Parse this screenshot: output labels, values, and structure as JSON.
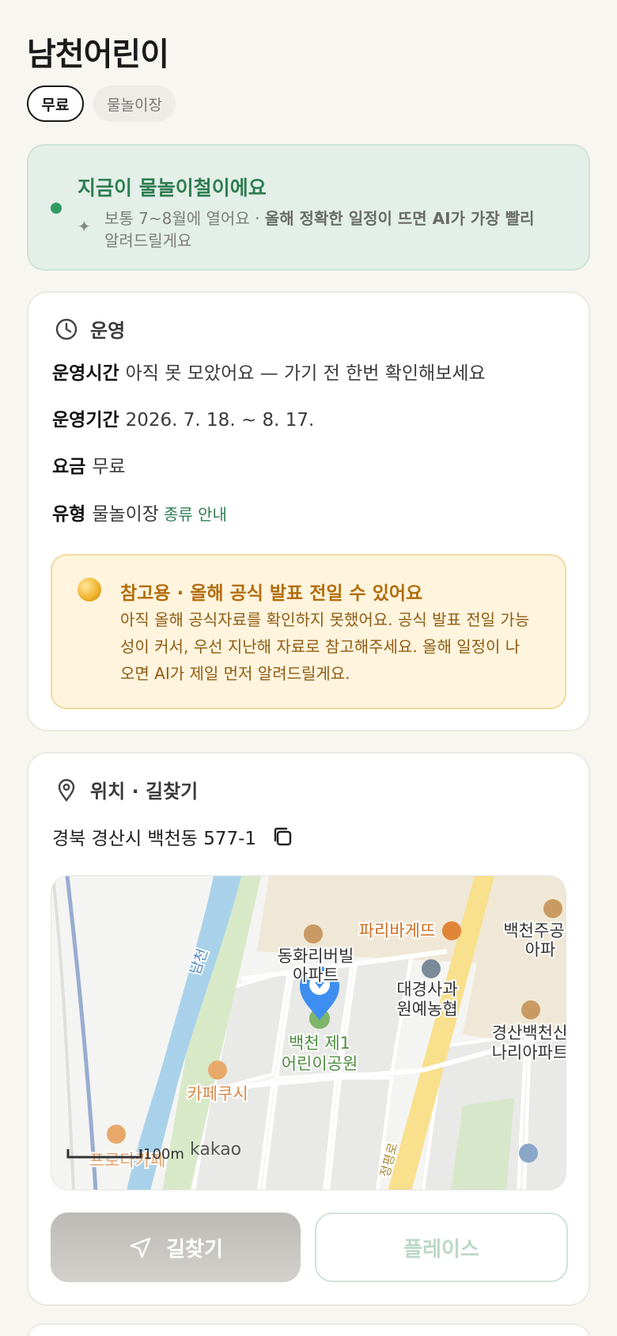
{
  "header": {
    "title": "남천어린이",
    "chips": [
      "무료",
      "물놀이장"
    ]
  },
  "season": {
    "headline": "지금이 물놀이철이에요",
    "sub_plain": "보통 7~8월에 열어요 · ",
    "sub_bold": "올해 정확한 일정이 뜨면 AI가 가장 빨리",
    "sub_tail": "알려드릴게요"
  },
  "operation": {
    "section_label": "운영",
    "rows": [
      {
        "key": "운영시간",
        "value": "아직 못 모았어요 — 가기 전 한번 확인해보세요"
      },
      {
        "key": "운영기간",
        "value": "2026. 7. 18. ~ 8. 17."
      },
      {
        "key": "요금",
        "value": "무료"
      },
      {
        "key": "유형",
        "value": "물놀이장",
        "link": "종류 안내"
      }
    ],
    "notice": {
      "title": "참고용 · 올해 공식 발표 전일 수 있어요",
      "body": "아직 올해 공식자료를 확인하지 못했어요. 공식 발표 전일 가능성이 커서, 우선 지난해 자료로 참고해주세요. 올해 일정이 나오면 AI가 제일 먼저 알려드릴게요."
    }
  },
  "location": {
    "section_label": "위치 · 길찾기",
    "address": "경북 경산시 백천동 577-1",
    "map": {
      "labels": {
        "river": "남천",
        "apt1_line1": "동화리버빌",
        "apt1_line2": "아파트",
        "bakery": "파리바게뜨",
        "apt2_line1": "백천주공",
        "apt2_line2": "아파",
        "bank_line1": "대경사과",
        "bank_line2": "원예농협",
        "apt3_line1": "경산백천산",
        "apt3_line2": "나리아파트",
        "park_line1": "백천 제1",
        "park_line2": "어린이공원",
        "cafe1": "카페쿠시",
        "cafe2": "프로다카페",
        "road": "정평로",
        "scale": "100m",
        "brand": "kakao"
      }
    },
    "buttons": {
      "route": "길찾기",
      "place": "플레이스"
    }
  },
  "colors": {
    "accent_green": "#2e7d52",
    "notice_orange": "#b26d0c",
    "pin_blue": "#3d8ef0"
  }
}
